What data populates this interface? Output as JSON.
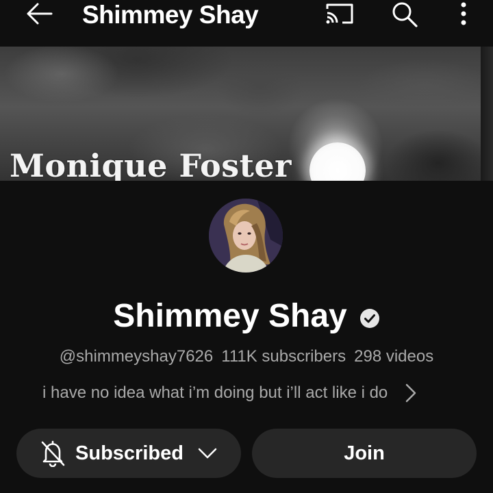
{
  "header": {
    "title": "Shimmey Shay",
    "icons": {
      "back": "arrow-left-icon",
      "cast": "cast-icon",
      "search": "search-icon",
      "more": "more-vert-icon"
    }
  },
  "banner": {
    "text": "Monique Foster"
  },
  "channel": {
    "name": "Shimmey Shay",
    "verified": true,
    "handle": "@shimmeyshay7626",
    "subscribers": "111K subscribers",
    "videos": "298 videos",
    "description": "i have no idea what i’m doing but i’ll act like i do"
  },
  "actions": {
    "subscribed_label": "Subscribed",
    "join_label": "Join"
  },
  "colors": {
    "background": "#0f0f0f",
    "button_bg": "#272727",
    "secondary_text": "#aaaaaa"
  }
}
